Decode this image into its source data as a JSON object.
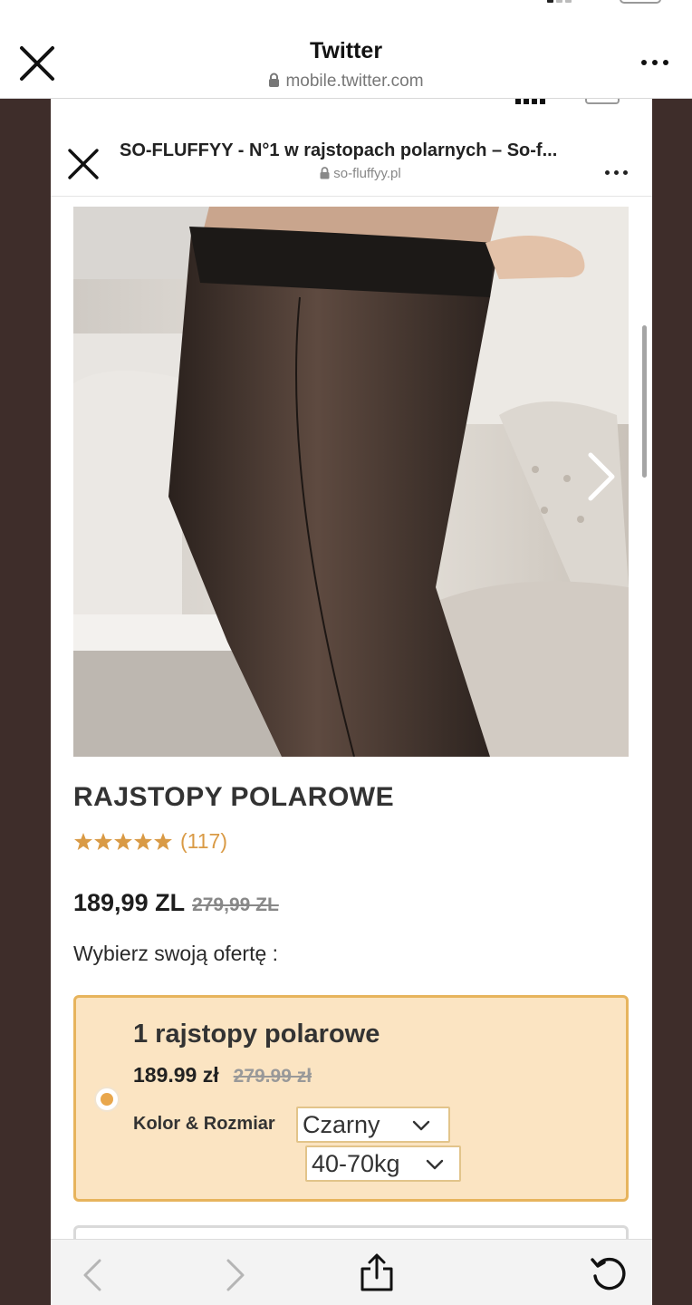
{
  "outer_header": {
    "title": "Twitter",
    "url": "mobile.twitter.com"
  },
  "inner_header": {
    "title": "SO-FLUFFYY - N°1 w rajstopach polarnych – So-f...",
    "url": "so-fluffyy.pl"
  },
  "product": {
    "title": "RAJSTOPY POLAROWE",
    "rating_stars": 5,
    "review_count": "(117)",
    "price": "189,99 ZL",
    "old_price": "279,99 ZL",
    "choose_label": "Wybierz swoją ofertę :"
  },
  "offer": {
    "title": "1 rajstopy polarowe",
    "price": "189.99 zł",
    "old_price": "279.99 zł",
    "selected": true,
    "option_label": "Kolor & Rozmiar",
    "color_value": "Czarny",
    "size_value": "40-70kg"
  },
  "colors": {
    "accent": "#e9a74c",
    "offer_background": "#fbe4c2",
    "offer_border": "#e7b45d",
    "star": "#d99a45",
    "page_frame": "#3e2d2a"
  },
  "icons": {
    "outer_close": "close-icon",
    "outer_more": "more-horizontal-icon",
    "lock": "lock-icon",
    "next": "chevron-right-icon",
    "back": "back-arrow-icon",
    "forward": "forward-arrow-icon",
    "share": "share-icon",
    "reload": "reload-icon"
  }
}
